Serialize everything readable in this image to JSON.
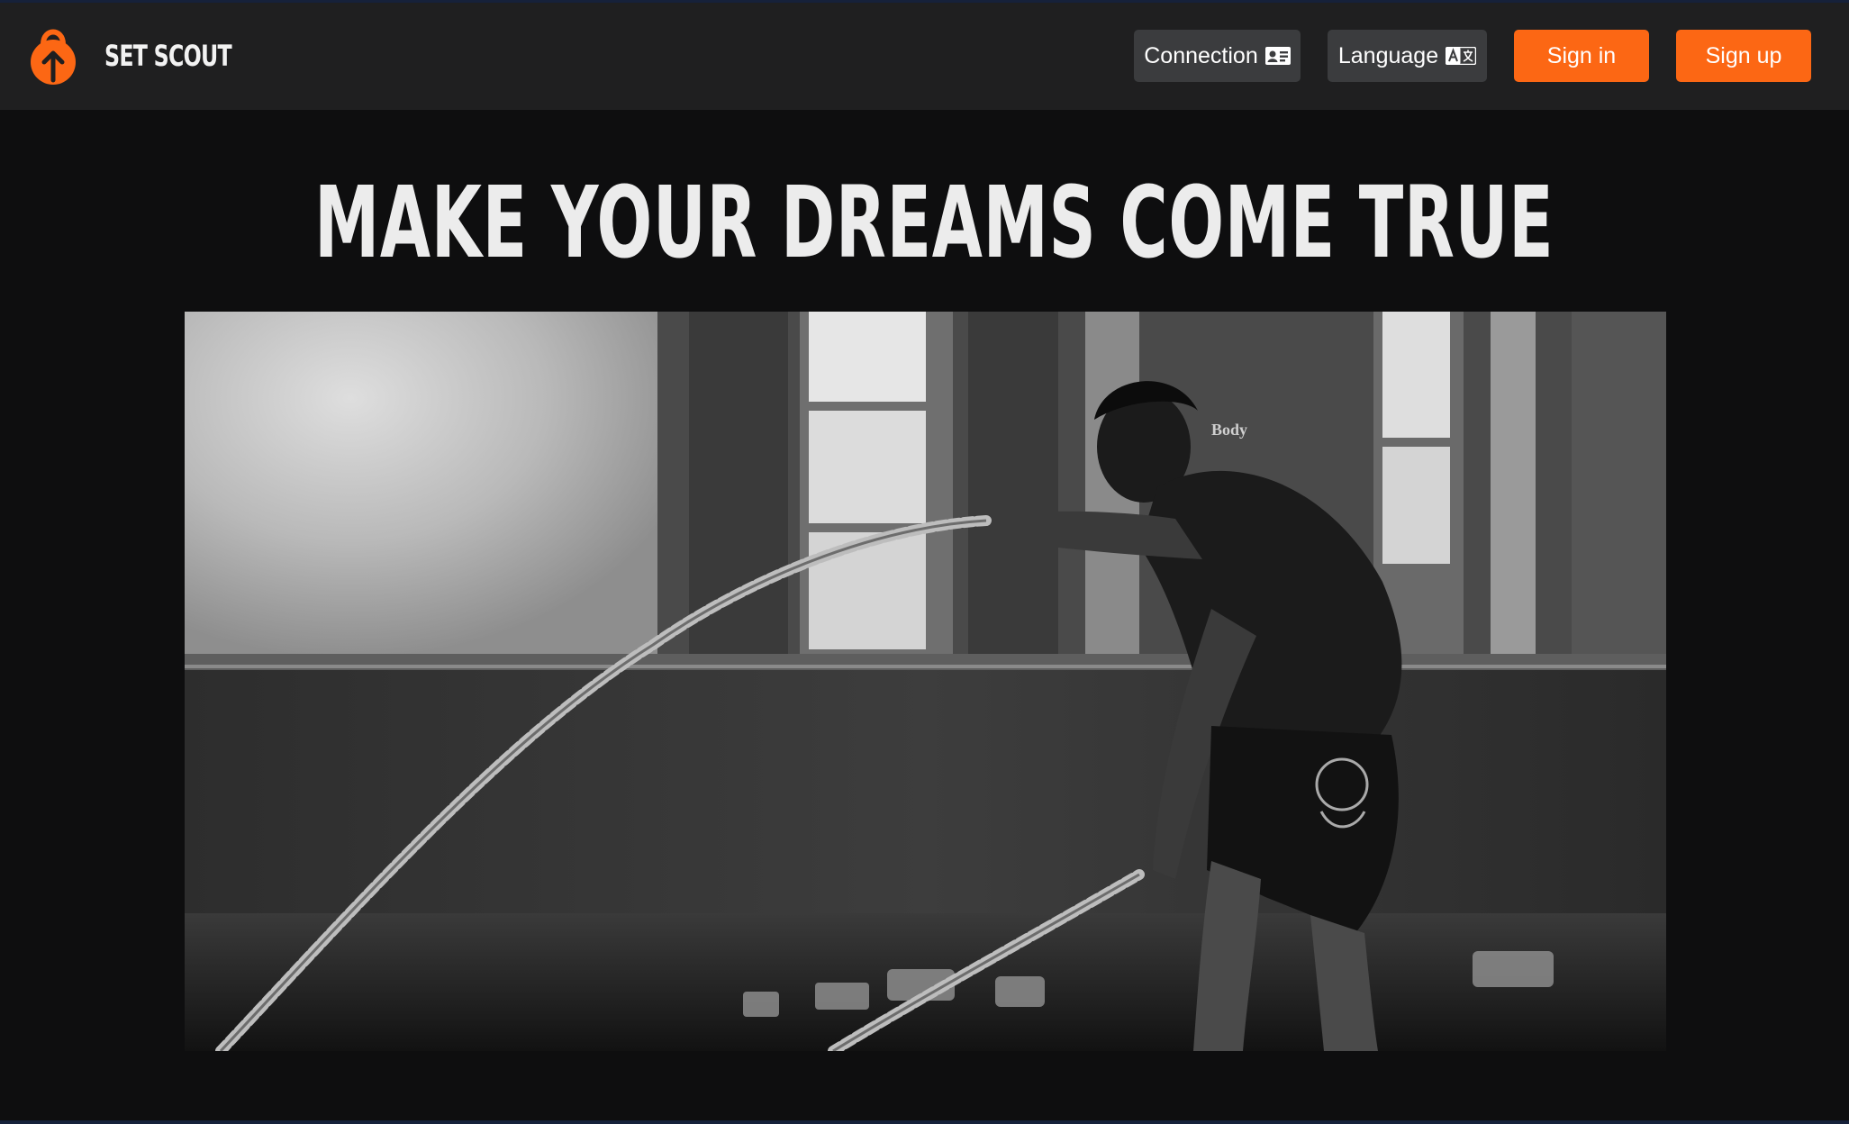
{
  "brand": {
    "name": "SET SCOUT",
    "logo_icon": "kettlebell-arrow-icon",
    "accent_color": "#fc6714"
  },
  "nav": {
    "connection": {
      "label": "Connection",
      "icon": "id-card-icon"
    },
    "language": {
      "label": "Language",
      "icon": "translate-icon"
    },
    "sign_in": {
      "label": "Sign in"
    },
    "sign_up": {
      "label": "Sign up"
    }
  },
  "hero": {
    "title": "MAKE YOUR DREAMS COME TRUE",
    "image": {
      "alt": "Black-and-white photo of a man training with battle ropes in a gym",
      "badge_text": "Body"
    }
  },
  "colors": {
    "background": "#0e0e0f",
    "navbar": "#1f1f20",
    "button_dark": "#3b3c3e",
    "button_orange": "#fc6714",
    "title_text": "#ececec"
  }
}
